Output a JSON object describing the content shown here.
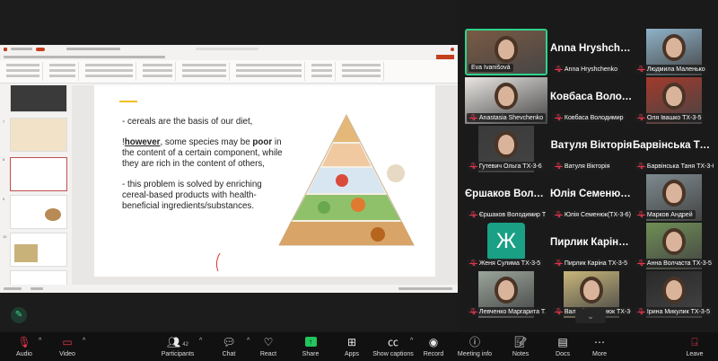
{
  "slide": {
    "bullets": [
      "- cereals are the basis of our diet,",
      [
        "!",
        "however",
        ", some species may be ",
        "poor",
        " in the content of a certain component, while they are rich in the content of others,"
      ],
      "- this problem is solved by enriching cereal-based products with health-beneficial ingredients/substances."
    ],
    "accent_color": "#f0c020",
    "image": "food-pyramid-illustration"
  },
  "participants": [
    {
      "label": "Eva Ivanišová",
      "type": "video",
      "full": true,
      "active": true,
      "color": "#7a5a44"
    },
    {
      "label": "Anna Hryshchenko",
      "display": "Anna  Hryshche...",
      "type": "name",
      "muted": true
    },
    {
      "label": "Людмила Маленько",
      "type": "video",
      "muted": true,
      "color": "#8fb3c9"
    },
    {
      "label": "Anastasia Shevchenko",
      "type": "video",
      "full": true,
      "muted": true,
      "color": "#e9e6e2"
    },
    {
      "label": "Ковбаса Володимир",
      "display": "Ковбаса  Волод...",
      "type": "name",
      "muted": true
    },
    {
      "label": "Оля Івашко ТХ-3-5",
      "type": "video",
      "muted": true,
      "color": "#a33a2c"
    },
    {
      "label": "Гутевич Ольга ТХ-3-6",
      "type": "video",
      "muted": true,
      "color": "#3a3a3a"
    },
    {
      "label": "Ватуля Вікторія",
      "display": "Ватуля Вікторія",
      "type": "name",
      "muted": true
    },
    {
      "label": "Барвінська Таня ТХ-3-6",
      "display": "Барвінська Тан...",
      "type": "name",
      "muted": true
    },
    {
      "label": "Єршаков Володимир ТХ-...",
      "display": "Єршаков  Воло...",
      "type": "name",
      "muted": true
    },
    {
      "label": "Юлія Семенюк(ТХ-3-6)",
      "display": "Юлія Семенюк...",
      "type": "name",
      "muted": true
    },
    {
      "label": "Марков Андрей",
      "type": "video",
      "muted": true,
      "color": "#7d8a8f"
    },
    {
      "label": "Женя Сулима ТХ-3-5",
      "type": "avatar",
      "letter": "Ж",
      "muted": true,
      "color": "#1aa085"
    },
    {
      "label": "Пирлик Каріна ТХ-3-5",
      "display": "Пирлик  Каріна...",
      "type": "name",
      "muted": true
    },
    {
      "label": "Анна Волчаста ТХ-3-5",
      "type": "video",
      "muted": true,
      "color": "#6f8f55"
    },
    {
      "label": "Левченко Маргарита ТХ-...",
      "type": "video",
      "muted": true,
      "color": "#9aa59b"
    },
    {
      "label": "Валерія Печенюк ТХ-3-6",
      "type": "video",
      "muted": true,
      "color": "#c8b67a"
    },
    {
      "label": "Ірина Микулик ТХ-3-5",
      "type": "video",
      "muted": true,
      "color": "#2a2a2a"
    }
  ],
  "toolbar": {
    "audio": "Audio",
    "video": "Video",
    "participants": "Participants",
    "participants_count": "42",
    "chat": "Chat",
    "react": "React",
    "share": "Share",
    "apps": "Apps",
    "captions": "Show captions",
    "record": "Record",
    "meeting_info": "Meeting info",
    "notes": "Notes",
    "docs": "Docs",
    "more": "More",
    "leave": "Leave",
    "share_color": "#22c55e",
    "muted_color": "#e0364b"
  }
}
